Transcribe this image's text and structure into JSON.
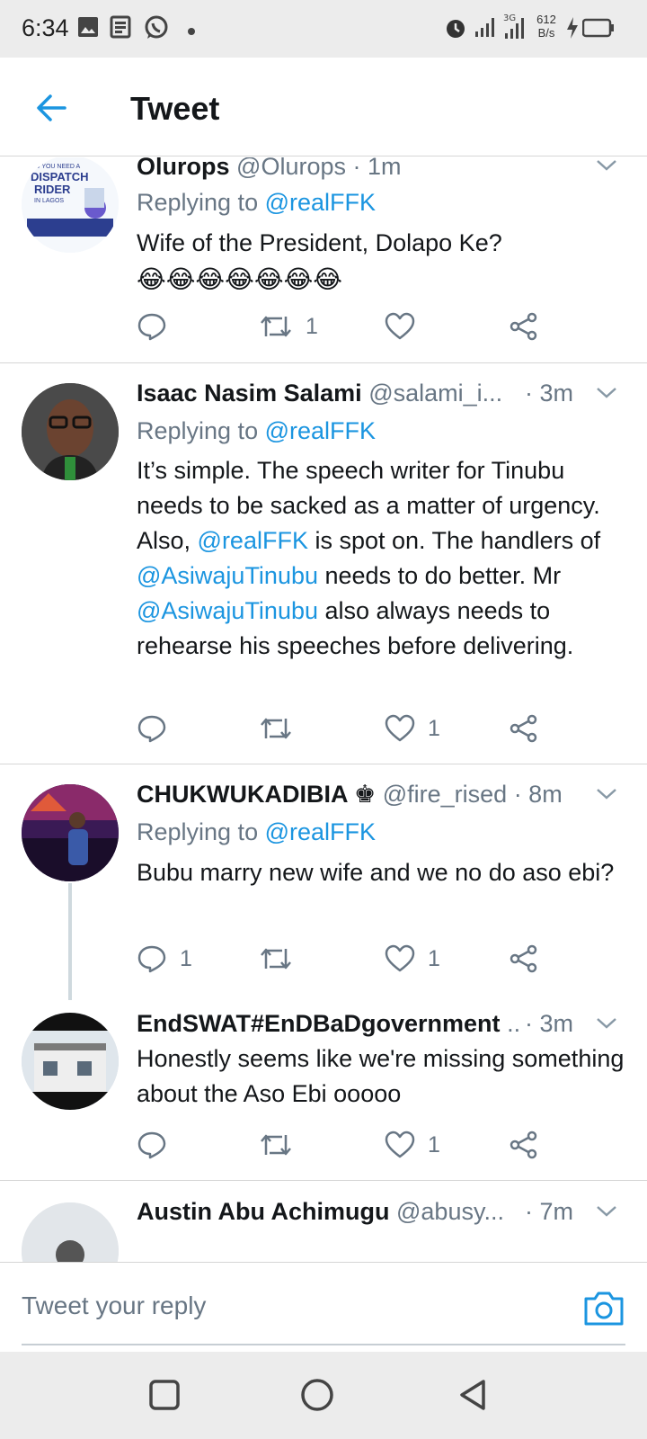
{
  "status_bar": {
    "time": "6:34",
    "net_speed_top": "612",
    "net_speed_bottom": "B/s",
    "icons": [
      "image-icon",
      "news-icon",
      "whatsapp-icon",
      "dot-icon",
      "alarm-icon",
      "signal-icon",
      "signal-3g-icon",
      "charging-icon",
      "battery-icon"
    ]
  },
  "header": {
    "title": "Tweet",
    "back_icon": "arrow-left-icon",
    "accent_color": "#1b95e0"
  },
  "tweets": [
    {
      "name": "Olurops",
      "handle": "@Olurops",
      "time": "· 1m",
      "replying_prefix": "Replying to",
      "replying_to": "@realFFK",
      "text": "Wife of the President, Dolapo Ke?",
      "emoji": "😂😂😂😂😂😂😂",
      "actions": {
        "reply": "",
        "retweet": "1",
        "like": ""
      }
    },
    {
      "name": "Isaac Nasim Salami",
      "handle": "@salami_i...",
      "time": "· 3m",
      "replying_prefix": "Replying to",
      "replying_to": "@realFFK",
      "text_parts": [
        "It’s simple. The speech writer for Tinubu needs to be sacked as a matter of urgency. Also, ",
        "@realFFK",
        " is spot on. The handlers of ",
        "@AsiwajuTinubu",
        " needs to do better. Mr ",
        "@AsiwajuTinubu",
        " also always needs to rehearse his speeches before delivering."
      ],
      "actions": {
        "reply": "",
        "retweet": "",
        "like": "1"
      }
    },
    {
      "name": "CHUKWUKADIBIA ♚",
      "handle": "@fire_rised",
      "time": "· 8m",
      "replying_prefix": "Replying to",
      "replying_to": "@realFFK",
      "text": "Bubu marry new wife and we no do aso ebi?",
      "actions": {
        "reply": "1",
        "retweet": "",
        "like": "1"
      }
    },
    {
      "name": "EndSWAT#EnDBaDgovernment",
      "handle": "...",
      "time": "· 3m",
      "text": "Honestly seems like we're missing something about the Aso Ebi ooooo",
      "actions": {
        "reply": "",
        "retweet": "",
        "like": "1"
      }
    },
    {
      "name": "Austin Abu Achimugu",
      "handle": "@abusy...",
      "time": "· 7m"
    }
  ],
  "avatar_text": {
    "line1": "DO YOU NEED A",
    "line2": "DISPATCH",
    "line3": "RIDER",
    "line4": "IN LAGOS"
  },
  "composer": {
    "placeholder": "Tweet your reply",
    "camera_icon": "camera-icon"
  },
  "nav_bar": {
    "icons": [
      "square-recents-icon",
      "circle-home-icon",
      "triangle-back-icon"
    ]
  }
}
